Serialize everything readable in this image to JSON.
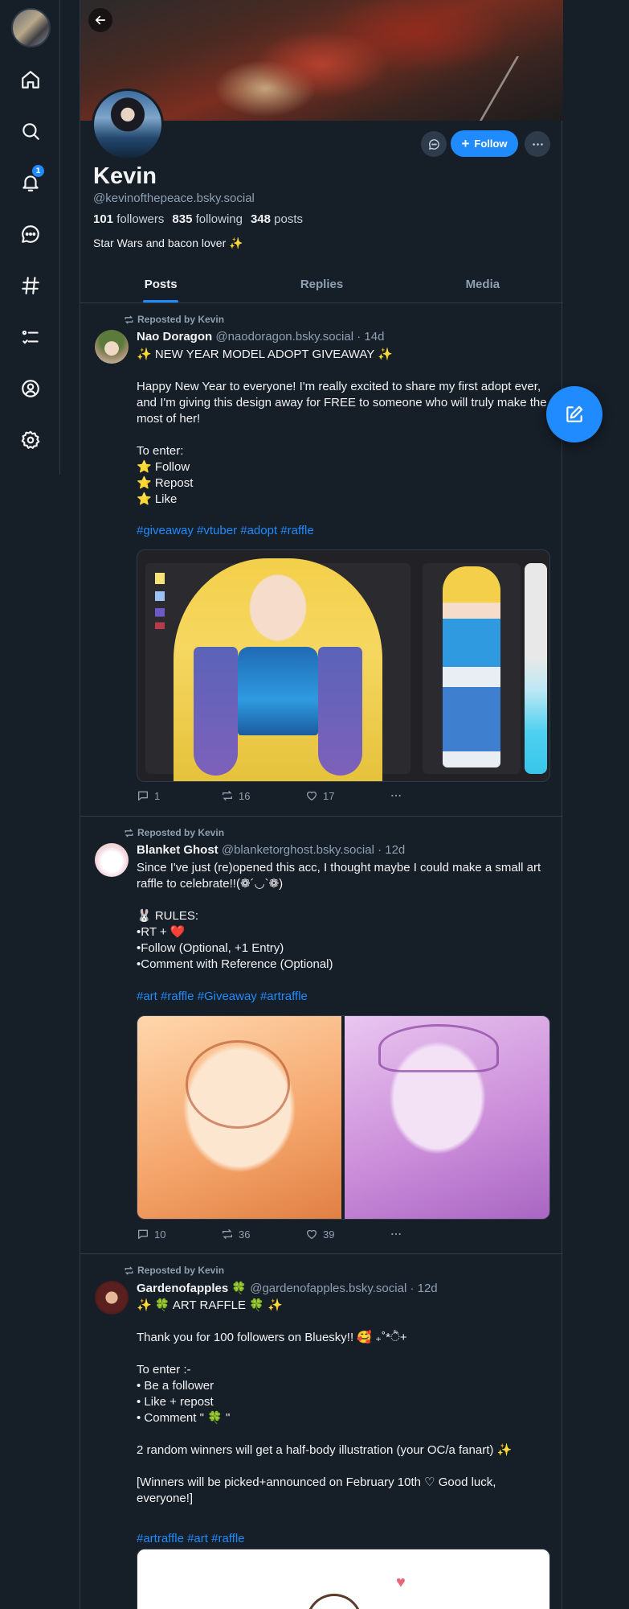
{
  "nav": {
    "notifications_badge": "1"
  },
  "profile": {
    "name": "Kevin",
    "handle": "@kevinofthepeace.bsky.social",
    "followers_count": "101",
    "followers_label": "followers",
    "following_count": "835",
    "following_label": "following",
    "posts_count": "348",
    "posts_label": "posts",
    "bio": "Star Wars and bacon lover ✨",
    "follow_label": "Follow"
  },
  "tabs": [
    {
      "label": "Posts",
      "active": true
    },
    {
      "label": "Replies",
      "active": false
    },
    {
      "label": "Media",
      "active": false
    }
  ],
  "posts": [
    {
      "repost_label": "Reposted by Kevin",
      "display_name": "Nao Doragon",
      "handle": "@naodoragon.bsky.social",
      "time": "· 14d",
      "text": "✨ NEW YEAR MODEL ADOPT GIVEAWAY ✨\n\nHappy New Year to everyone! I'm really excited to share my first adopt ever, and I'm giving this design away for FREE to someone who will truly make the most of her!\n\nTo enter:\n⭐ Follow\n⭐ Repost\n⭐ Like",
      "tags": "#giveaway #vtuber #adopt #raffle",
      "replies": "1",
      "reposts": "16",
      "likes": "17"
    },
    {
      "repost_label": "Reposted by Kevin",
      "display_name": "Blanket Ghost",
      "handle": "@blanketorghost.bsky.social",
      "time": "· 12d",
      "text": "Since I've just (re)opened this acc, I thought maybe I could make a small art raffle to celebrate!!(❁´◡`❁)\n\n🐰 RULES:\n•RT + ❤️\n•Follow (Optional, +1 Entry)\n•Comment with Reference (Optional)",
      "tags": "#art #raffle #Giveaway #artraffle",
      "replies": "10",
      "reposts": "36",
      "likes": "39"
    },
    {
      "repost_label": "Reposted by Kevin",
      "display_name": "Gardenofapples 🍀",
      "handle": "@gardenofapples.bsky.social",
      "time": "· 12d",
      "text": "✨ 🍀 ART RAFFLE 🍀 ✨\n\nThank you for 100 followers on Bluesky!! 🥰 ₊˚*ੈ+\n\nTo enter :-\n• Be a follower\n• Like + repost\n• Comment \" 🍀 \"\n\n2 random winners will get a half-body illustration (your OC/a fanart) ✨\n\n[Winners will be picked+announced on February 10th ♡ Good luck, everyone!]",
      "tags": "#artraffle #art #raffle"
    }
  ]
}
